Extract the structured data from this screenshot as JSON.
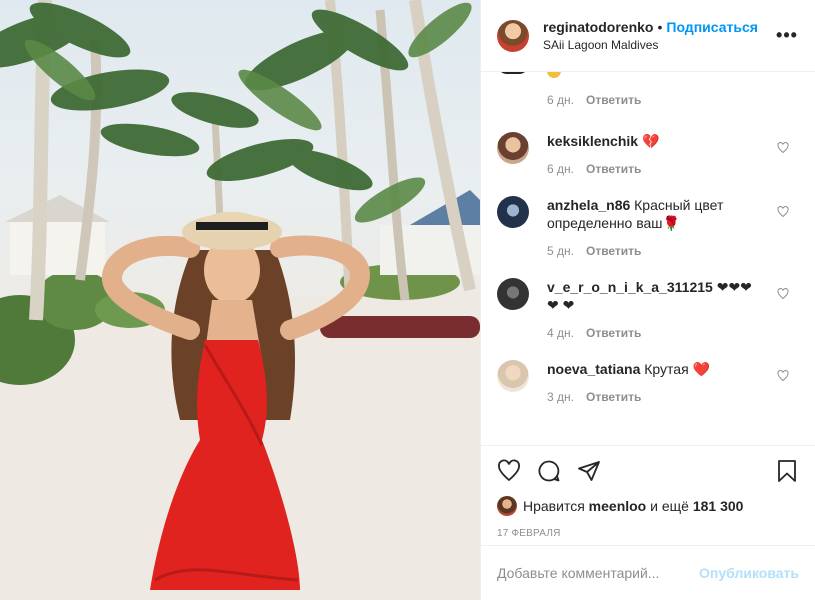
{
  "post": {
    "username": "reginatodorenko",
    "separator": "•",
    "follow_label": "Подписаться",
    "location": "SAii Lagoon Maldives",
    "more_glyph": "•••"
  },
  "comments": {
    "previous": {
      "time": "6 дн.",
      "reply": "Ответить"
    },
    "items": [
      {
        "user": "keksiklenchik",
        "text": "💔",
        "time": "6 дн.",
        "reply": "Ответить"
      },
      {
        "user": "anzhela_n86",
        "text": "Красный цвет определенно ваш🌹",
        "time": "5 дн.",
        "reply": "Ответить"
      },
      {
        "user": "v_e_r_o_n_i_k_a_311215",
        "text": "❤❤❤❤ ❤",
        "time": "4 дн.",
        "reply": "Ответить"
      },
      {
        "user": "noeva_tatiana",
        "text": "Крутая ❤️",
        "time": "3 дн.",
        "reply": "Ответить"
      }
    ]
  },
  "likes": {
    "prefix": "Нравится",
    "user": "meenloo",
    "suffix": "и ещё 181 300"
  },
  "date": "17 ФЕВРАЛЯ",
  "add_comment": {
    "placeholder": "Добавьте комментарий...",
    "publish": "Опубликовать"
  },
  "colors": {
    "accent": "#0095f6",
    "publish_disabled": "#b2dffc",
    "dress": "#e0231f",
    "like_heart": "#ed4956"
  },
  "icons": [
    "heart-icon",
    "comment-icon",
    "share-icon",
    "bookmark-icon",
    "more-icon"
  ]
}
